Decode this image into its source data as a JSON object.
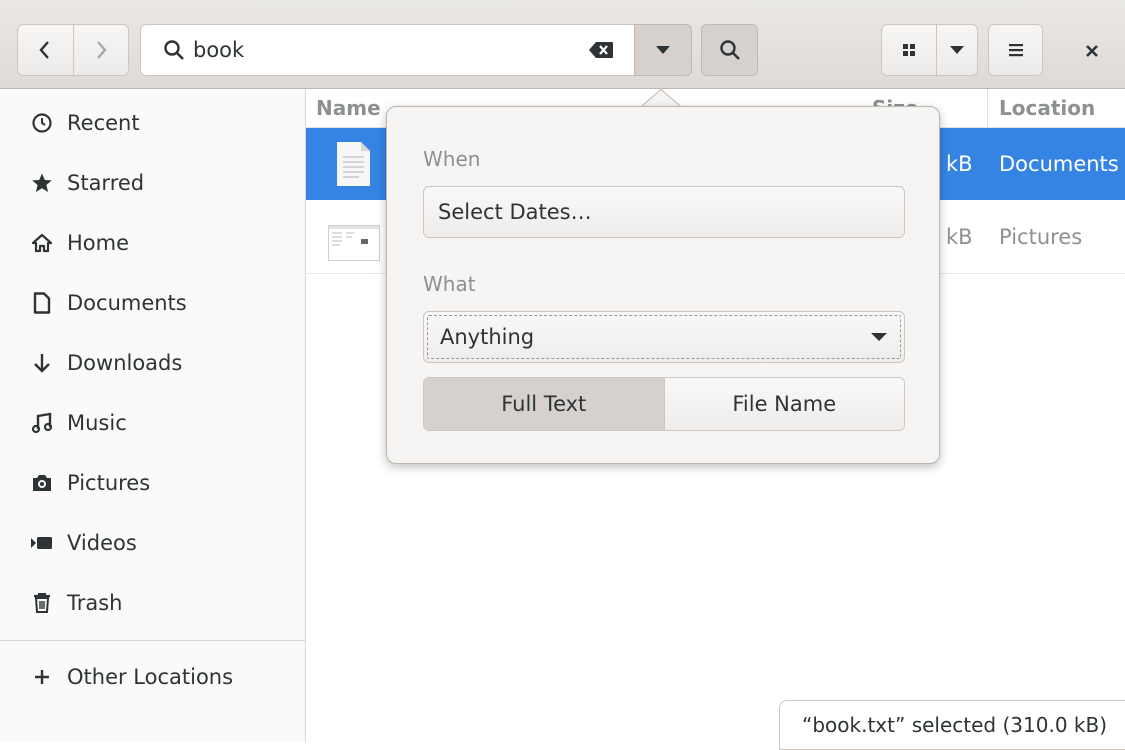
{
  "header": {
    "search_text": "book"
  },
  "sidebar": {
    "items": [
      {
        "label": "Recent",
        "icon": "clock-icon"
      },
      {
        "label": "Starred",
        "icon": "star-icon"
      },
      {
        "label": "Home",
        "icon": "home-icon"
      },
      {
        "label": "Documents",
        "icon": "document-icon"
      },
      {
        "label": "Downloads",
        "icon": "download-icon"
      },
      {
        "label": "Music",
        "icon": "music-icon"
      },
      {
        "label": "Pictures",
        "icon": "camera-icon"
      },
      {
        "label": "Videos",
        "icon": "video-icon"
      },
      {
        "label": "Trash",
        "icon": "trash-icon"
      }
    ],
    "other_locations": "Other Locations"
  },
  "list": {
    "columns": {
      "name": "Name",
      "size": "Size",
      "location": "Location"
    },
    "rows": [
      {
        "size_fragment": "kB",
        "location": "Documents",
        "selected": true,
        "icon": "text-file-icon"
      },
      {
        "size_fragment": "kB",
        "location": "Pictures",
        "selected": false,
        "icon": "image-thumbnail-icon"
      }
    ]
  },
  "popover": {
    "when_label": "When",
    "select_dates": "Select Dates…",
    "what_label": "What",
    "what_value": "Anything",
    "full_text": "Full Text",
    "file_name": "File Name"
  },
  "status": "“book.txt” selected  (310.0 kB)",
  "colors": {
    "selection": "#3584e4",
    "header_bg": "#e3e0dc"
  }
}
